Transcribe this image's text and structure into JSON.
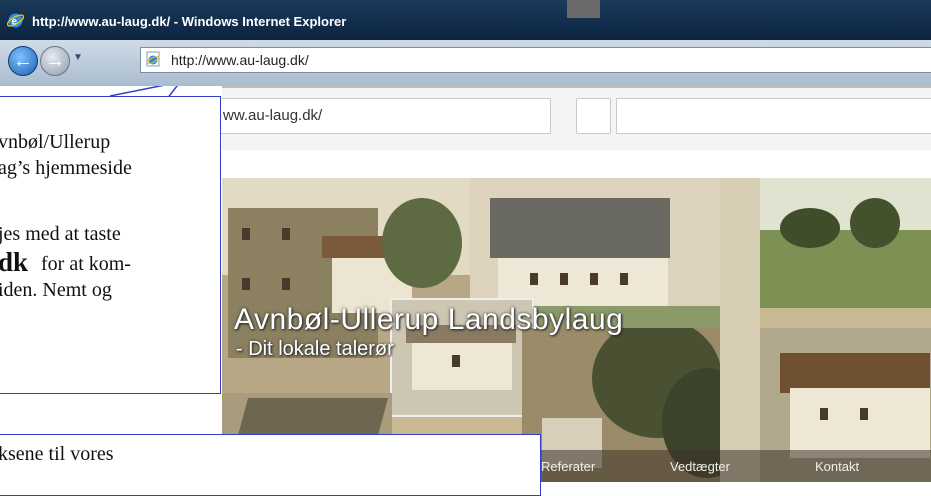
{
  "window": {
    "title": "http://www.au-laug.dk/ - Windows Internet Explorer"
  },
  "navbar": {
    "address": "http://www.au-laug.dk/"
  },
  "inner_browser": {
    "address": "ww.au-laug.dk/"
  },
  "banner": {
    "title": "Avnbøl-Ullerup Landsbylaug",
    "subtitle": "- Dit lokale talerør",
    "menu": [
      "Referater",
      "Vedtægter",
      "Kontakt"
    ]
  },
  "callout_top": {
    "lines": [
      "vnbøl/Ullerup",
      "ag’s hjemmeside",
      "",
      "jes med at taste",
      "for at kom-",
      "iden. Nemt og"
    ],
    "bold_text": "dk"
  },
  "callout_bottom": {
    "text": "ksene til vores"
  },
  "colors": {
    "titlebar": "#0b2440",
    "callout_border": "#3040c8",
    "banner_text": "#ffffff"
  }
}
